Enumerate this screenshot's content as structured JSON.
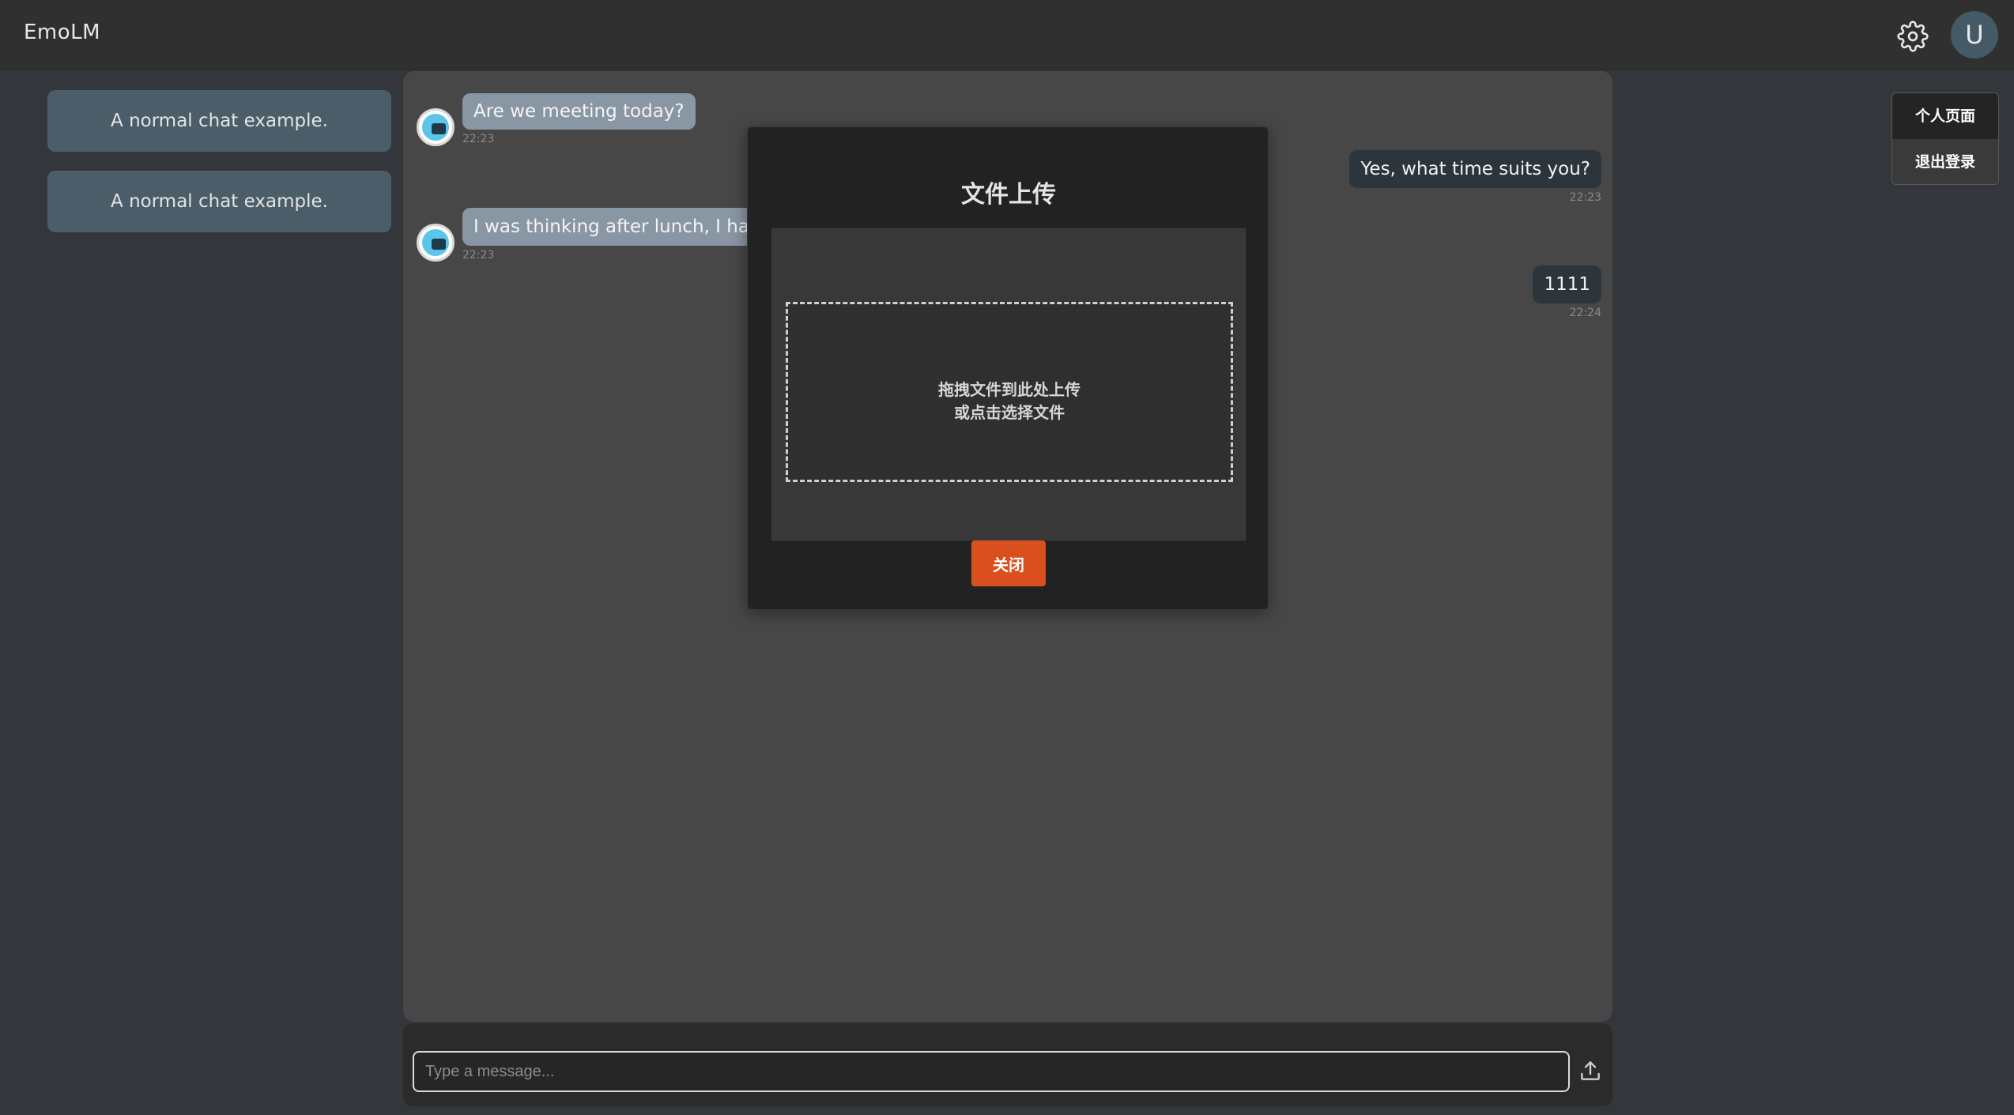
{
  "header": {
    "app_title": "EmoLM",
    "settings_icon": "gear-icon",
    "avatar_initial": "U"
  },
  "user_menu": {
    "items": [
      {
        "label": "个人页面"
      },
      {
        "label": "退出登录"
      }
    ]
  },
  "sidebar": {
    "items": [
      {
        "label": "A normal chat example."
      },
      {
        "label": "A normal chat example."
      }
    ]
  },
  "chat": {
    "messages": [
      {
        "role": "bot",
        "text": "Are we meeting today?",
        "time": "22:23"
      },
      {
        "role": "user",
        "text": "Yes, what time suits you?",
        "time": "22:23"
      },
      {
        "role": "bot",
        "text": "I was thinking after lunch, I have a meeting in the morning.",
        "time": "22:23"
      },
      {
        "role": "user",
        "text": "1111",
        "time": "22:24"
      }
    ]
  },
  "composer": {
    "placeholder": "Type a message...",
    "upload_icon": "upload-icon"
  },
  "modal": {
    "title": "文件上传",
    "drop_line1": "拖拽文件到此处上传",
    "drop_line2": "或点击选择文件",
    "close_label": "关闭"
  },
  "colors": {
    "accent": "#d9501e",
    "sidebar_item": "#4b5d68",
    "bot_bubble": "#8996a3",
    "user_bubble": "#2c353b"
  }
}
